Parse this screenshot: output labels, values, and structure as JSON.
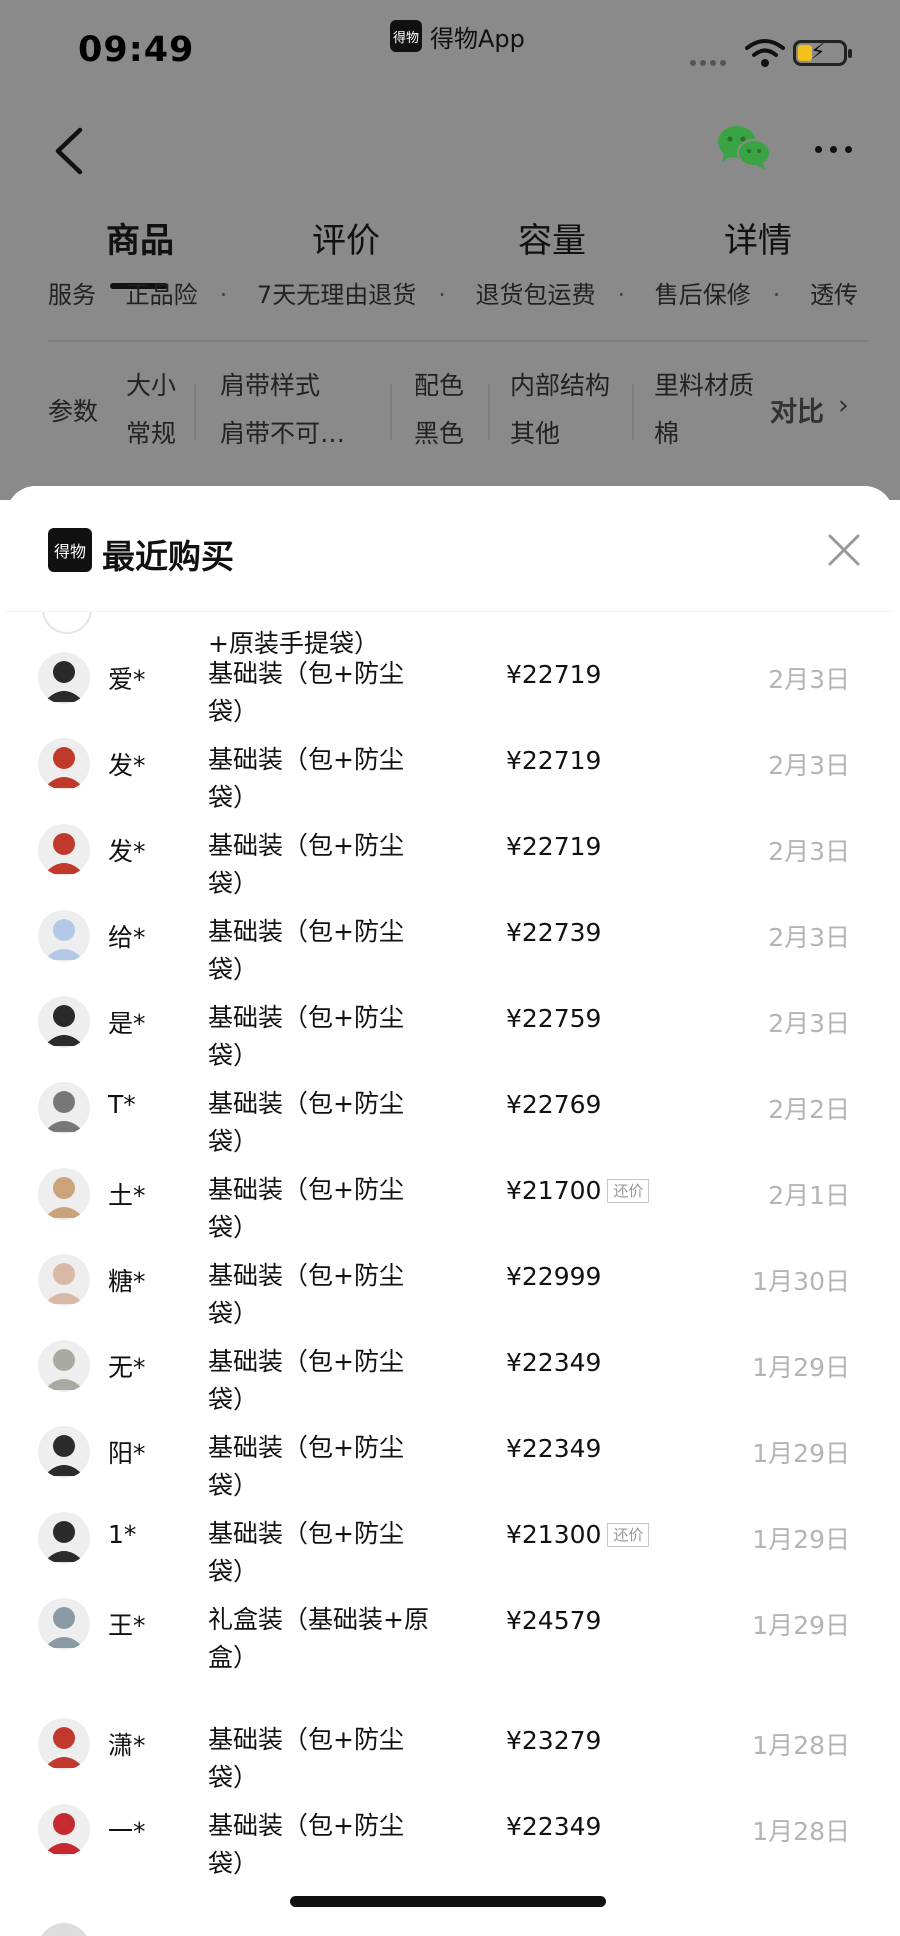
{
  "status_bar": {
    "time": "09:49",
    "app_name": "得物App",
    "app_logo_text": "得物"
  },
  "nav": {
    "back_icon": "chevron-left-icon",
    "share_icon": "wechat-icon",
    "more_icon": "more-dots-icon"
  },
  "tabs": [
    {
      "label": "商品",
      "active": true
    },
    {
      "label": "评价",
      "active": false
    },
    {
      "label": "容量",
      "active": false
    },
    {
      "label": "详情",
      "active": false
    }
  ],
  "service": {
    "label": "服务",
    "items": [
      "正品险",
      "7天无理由退货",
      "退货包运费",
      "售后保修",
      "透传"
    ]
  },
  "params": {
    "label": "参数",
    "columns": [
      {
        "name": "大小",
        "value": "常规"
      },
      {
        "name": "肩带样式",
        "value": "肩带不可…"
      },
      {
        "name": "配色",
        "value": "黑色"
      },
      {
        "name": "内部结构",
        "value": "其他"
      },
      {
        "name": "里料材质",
        "value": "棉"
      }
    ],
    "compare_label": "对比"
  },
  "sheet": {
    "logo_text": "得物",
    "title": "最近购买",
    "close_icon": "close-icon",
    "partial_top_text": "+原装手提袋）",
    "haggle_label": "还价",
    "rows": [
      {
        "name": "爱*",
        "spec": "基础装（包+防尘袋）",
        "price": "¥22719",
        "date": "2月3日",
        "haggle": false
      },
      {
        "name": "发*",
        "spec": "基础装（包+防尘袋）",
        "price": "¥22719",
        "date": "2月3日",
        "haggle": false
      },
      {
        "name": "发*",
        "spec": "基础装（包+防尘袋）",
        "price": "¥22719",
        "date": "2月3日",
        "haggle": false
      },
      {
        "name": "给*",
        "spec": "基础装（包+防尘袋）",
        "price": "¥22739",
        "date": "2月3日",
        "haggle": false
      },
      {
        "name": "是*",
        "spec": "基础装（包+防尘袋）",
        "price": "¥22759",
        "date": "2月3日",
        "haggle": false
      },
      {
        "name": "T*",
        "spec": "基础装（包+防尘袋）",
        "price": "¥22769",
        "date": "2月2日",
        "haggle": false
      },
      {
        "name": "土*",
        "spec": "基础装（包+防尘袋）",
        "price": "¥21700",
        "date": "2月1日",
        "haggle": true
      },
      {
        "name": "糖*",
        "spec": "基础装（包+防尘袋）",
        "price": "¥22999",
        "date": "1月30日",
        "haggle": false
      },
      {
        "name": "无*",
        "spec": "基础装（包+防尘袋）",
        "price": "¥22349",
        "date": "1月29日",
        "haggle": false
      },
      {
        "name": "阳*",
        "spec": "基础装（包+防尘袋）",
        "price": "¥22349",
        "date": "1月29日",
        "haggle": false
      },
      {
        "name": "1*",
        "spec": "基础装（包+防尘袋）",
        "price": "¥21300",
        "date": "1月29日",
        "haggle": true
      },
      {
        "name": "王*",
        "spec": "礼盒装（基础装+原盒）",
        "price": "¥24579",
        "date": "1月29日",
        "haggle": false
      },
      {
        "name": "潇*",
        "spec": "基础装（包+防尘袋）",
        "price": "¥23279",
        "date": "1月28日",
        "haggle": false
      },
      {
        "name": "一*",
        "spec": "基础装（包+防尘袋）",
        "price": "¥22349",
        "date": "1月28日",
        "haggle": false
      }
    ]
  },
  "colors": {
    "overlay": "#8a8a8a",
    "date": "#b4b4b4",
    "wechat": "#3aa344",
    "battery": "#f3c11b"
  }
}
